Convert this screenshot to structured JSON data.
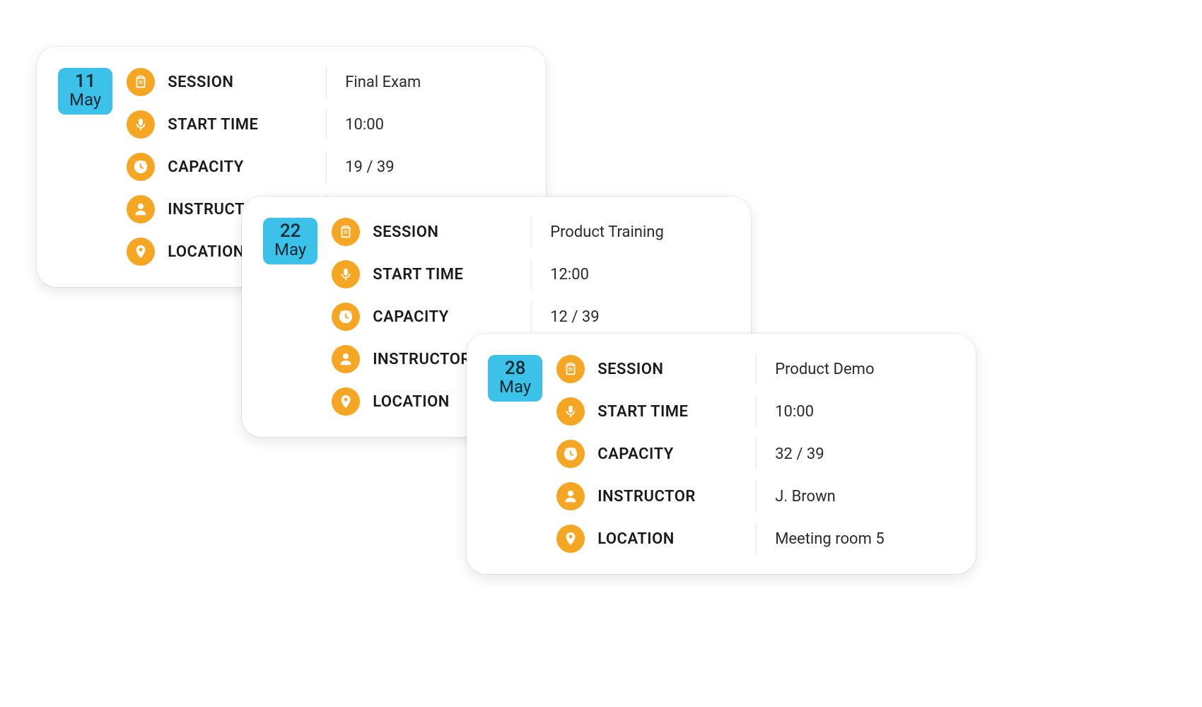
{
  "labels": {
    "session": "SESSION",
    "start_time": "START TIME",
    "capacity": "CAPACITY",
    "instructor": "INSTRUCTOR",
    "location": "LOCATION"
  },
  "cards": [
    {
      "date": {
        "day": "11",
        "month": "May"
      },
      "session": "Final Exam",
      "start_time": "10:00",
      "capacity": "19 / 39",
      "instructor": "",
      "location": ""
    },
    {
      "date": {
        "day": "22",
        "month": "May"
      },
      "session": "Product Training",
      "start_time": "12:00",
      "capacity": "12 / 39",
      "instructor": "",
      "location": ""
    },
    {
      "date": {
        "day": "28",
        "month": "May"
      },
      "session": "Product Demo",
      "start_time": "10:00",
      "capacity": "32 / 39",
      "instructor": "J. Brown",
      "location": "Meeting room 5"
    }
  ],
  "colors": {
    "accent_orange": "#F5A623",
    "accent_cyan": "#3CC1E9"
  }
}
